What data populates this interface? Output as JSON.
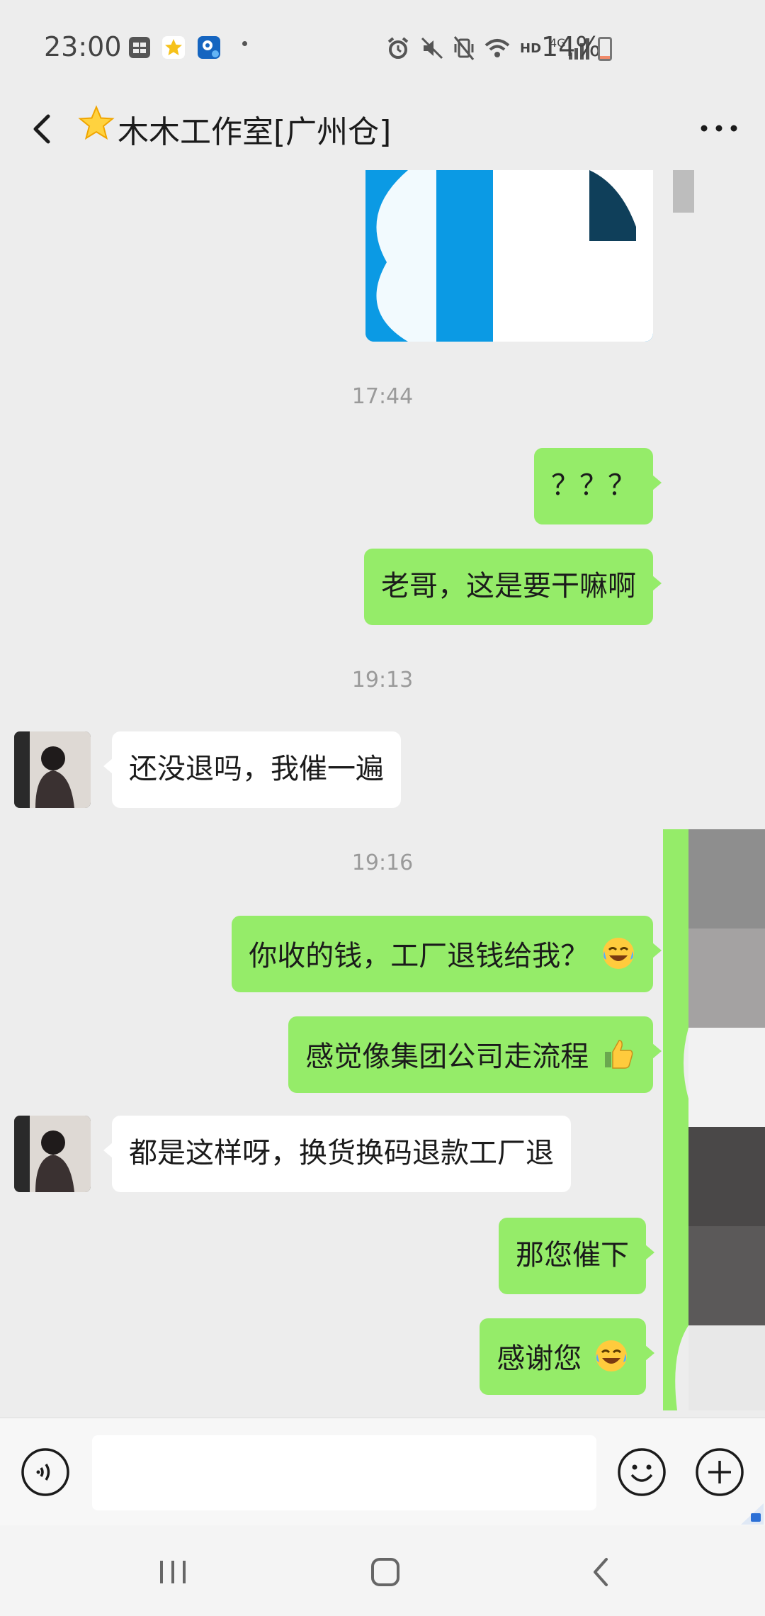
{
  "status_bar": {
    "time": "23:00",
    "network": "HD",
    "signal_label": "4G",
    "battery_percent": "14%",
    "battery_level": 0.14,
    "icons": [
      "calendar-icon",
      "star-app-icon",
      "map-app-icon",
      "alarm-icon",
      "mute-icon",
      "vibrate-icon",
      "wifi-icon",
      "signal-icon",
      "battery-icon"
    ]
  },
  "header": {
    "title": "木木工作室[广州仓]",
    "title_icon": "star-icon",
    "back_icon": "chevron-left-icon",
    "more_icon": "more-dots-icon"
  },
  "chat": {
    "timestamps": [
      "17:44",
      "19:13",
      "19:16"
    ],
    "messages": [
      {
        "from": "me",
        "text": "？？？"
      },
      {
        "from": "me",
        "text": "老哥，这是要干嘛啊"
      },
      {
        "from": "contact",
        "text": "还没退吗，我催一遍"
      },
      {
        "from": "me",
        "text": "你收的钱，工厂退钱给我？",
        "emoji": "laughing-crying-emoji"
      },
      {
        "from": "me",
        "text": "感觉像集团公司走流程",
        "emoji": "thumbs-up-emoji"
      },
      {
        "from": "contact",
        "text": "都是这样呀，换货换码退款工厂退"
      },
      {
        "from": "me",
        "text": "那您催下"
      },
      {
        "from": "me",
        "text": "感谢您",
        "emoji": "laughing-crying-emoji"
      }
    ]
  },
  "input_bar": {
    "voice_icon": "voice-icon",
    "emoji_icon": "smiley-icon",
    "plus_icon": "plus-icon",
    "value": ""
  },
  "colors": {
    "outgoing_bubble": "#95ec69",
    "incoming_bubble": "#ffffff",
    "background": "#ededed"
  }
}
